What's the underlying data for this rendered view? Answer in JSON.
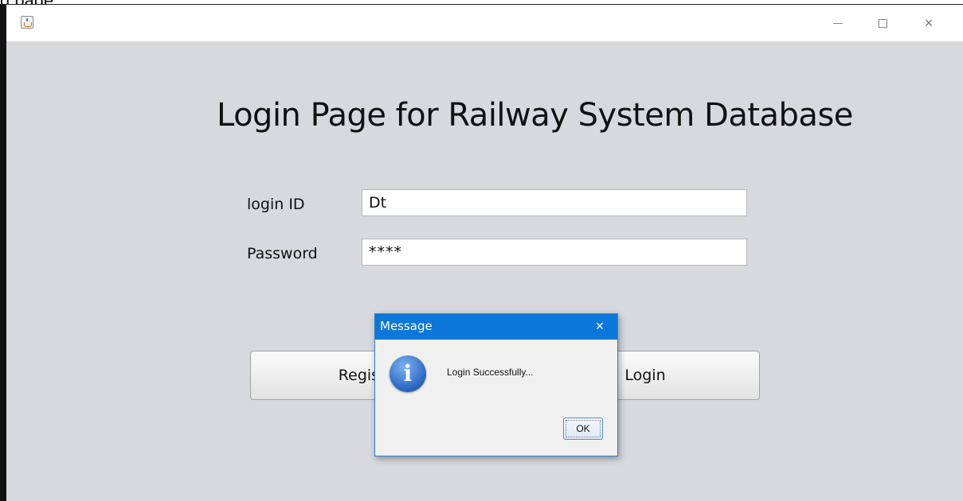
{
  "top_caption": "g   page",
  "window": {
    "controls": {
      "minimize": "minimize",
      "maximize": "maximize",
      "close": "close"
    }
  },
  "page": {
    "title": "Login Page for Railway System Database",
    "login_label": "login ID",
    "login_value": "Dt",
    "password_label": "Password",
    "password_value": "****",
    "register_button": "Registe",
    "login_button": "Login"
  },
  "dialog": {
    "title": "Message",
    "close": "×",
    "message": "Login Successfully...",
    "ok": "OK",
    "icon": "info-icon"
  }
}
